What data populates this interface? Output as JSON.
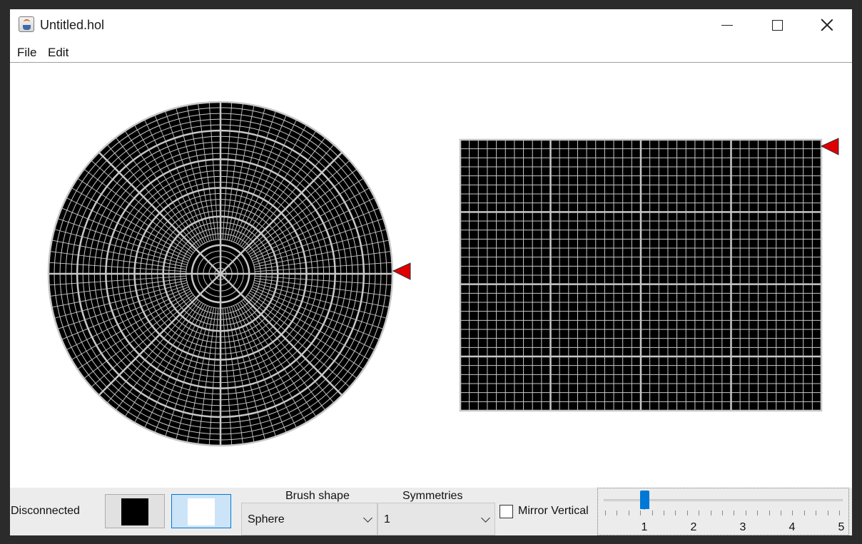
{
  "window": {
    "title": "Untitled.hol"
  },
  "menu": {
    "items": [
      "File",
      "Edit"
    ]
  },
  "status": {
    "connection": "Disconnected"
  },
  "colors": {
    "foreground": "#000000",
    "background": "#ffffff",
    "grid_line": "#c8c8c8",
    "marker": "#e00000",
    "accent": "#0078d7"
  },
  "brush": {
    "label": "Brush shape",
    "value": "Sphere"
  },
  "symmetry": {
    "label": "Symmetries",
    "value": "1"
  },
  "mirror": {
    "label": "Mirror Vertical",
    "checked": false
  },
  "slider": {
    "value": 1,
    "min": 1,
    "max": 5,
    "labels": [
      "1",
      "2",
      "3",
      "4",
      "5"
    ]
  },
  "icons": {
    "app": "java-cup-icon",
    "marker": "red-triangle-marker-icon"
  }
}
